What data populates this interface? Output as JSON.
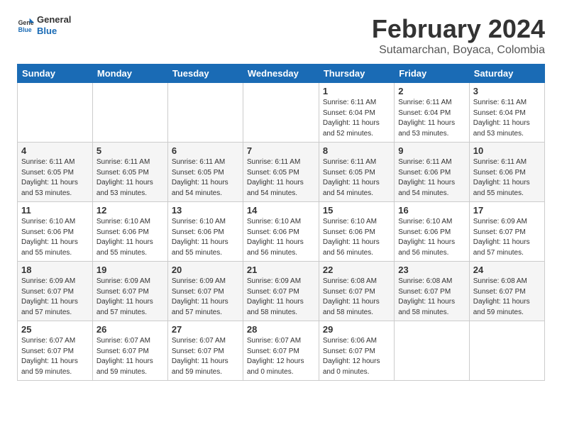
{
  "header": {
    "logo": {
      "general": "General",
      "blue": "Blue"
    },
    "title": "February 2024",
    "subtitle": "Sutamarchan, Boyaca, Colombia"
  },
  "days_of_week": [
    "Sunday",
    "Monday",
    "Tuesday",
    "Wednesday",
    "Thursday",
    "Friday",
    "Saturday"
  ],
  "weeks": [
    [
      {
        "day": "",
        "info": ""
      },
      {
        "day": "",
        "info": ""
      },
      {
        "day": "",
        "info": ""
      },
      {
        "day": "",
        "info": ""
      },
      {
        "day": "1",
        "info": "Sunrise: 6:11 AM\nSunset: 6:04 PM\nDaylight: 11 hours\nand 52 minutes."
      },
      {
        "day": "2",
        "info": "Sunrise: 6:11 AM\nSunset: 6:04 PM\nDaylight: 11 hours\nand 53 minutes."
      },
      {
        "day": "3",
        "info": "Sunrise: 6:11 AM\nSunset: 6:04 PM\nDaylight: 11 hours\nand 53 minutes."
      }
    ],
    [
      {
        "day": "4",
        "info": "Sunrise: 6:11 AM\nSunset: 6:05 PM\nDaylight: 11 hours\nand 53 minutes."
      },
      {
        "day": "5",
        "info": "Sunrise: 6:11 AM\nSunset: 6:05 PM\nDaylight: 11 hours\nand 53 minutes."
      },
      {
        "day": "6",
        "info": "Sunrise: 6:11 AM\nSunset: 6:05 PM\nDaylight: 11 hours\nand 54 minutes."
      },
      {
        "day": "7",
        "info": "Sunrise: 6:11 AM\nSunset: 6:05 PM\nDaylight: 11 hours\nand 54 minutes."
      },
      {
        "day": "8",
        "info": "Sunrise: 6:11 AM\nSunset: 6:05 PM\nDaylight: 11 hours\nand 54 minutes."
      },
      {
        "day": "9",
        "info": "Sunrise: 6:11 AM\nSunset: 6:06 PM\nDaylight: 11 hours\nand 54 minutes."
      },
      {
        "day": "10",
        "info": "Sunrise: 6:11 AM\nSunset: 6:06 PM\nDaylight: 11 hours\nand 55 minutes."
      }
    ],
    [
      {
        "day": "11",
        "info": "Sunrise: 6:10 AM\nSunset: 6:06 PM\nDaylight: 11 hours\nand 55 minutes."
      },
      {
        "day": "12",
        "info": "Sunrise: 6:10 AM\nSunset: 6:06 PM\nDaylight: 11 hours\nand 55 minutes."
      },
      {
        "day": "13",
        "info": "Sunrise: 6:10 AM\nSunset: 6:06 PM\nDaylight: 11 hours\nand 55 minutes."
      },
      {
        "day": "14",
        "info": "Sunrise: 6:10 AM\nSunset: 6:06 PM\nDaylight: 11 hours\nand 56 minutes."
      },
      {
        "day": "15",
        "info": "Sunrise: 6:10 AM\nSunset: 6:06 PM\nDaylight: 11 hours\nand 56 minutes."
      },
      {
        "day": "16",
        "info": "Sunrise: 6:10 AM\nSunset: 6:06 PM\nDaylight: 11 hours\nand 56 minutes."
      },
      {
        "day": "17",
        "info": "Sunrise: 6:09 AM\nSunset: 6:07 PM\nDaylight: 11 hours\nand 57 minutes."
      }
    ],
    [
      {
        "day": "18",
        "info": "Sunrise: 6:09 AM\nSunset: 6:07 PM\nDaylight: 11 hours\nand 57 minutes."
      },
      {
        "day": "19",
        "info": "Sunrise: 6:09 AM\nSunset: 6:07 PM\nDaylight: 11 hours\nand 57 minutes."
      },
      {
        "day": "20",
        "info": "Sunrise: 6:09 AM\nSunset: 6:07 PM\nDaylight: 11 hours\nand 57 minutes."
      },
      {
        "day": "21",
        "info": "Sunrise: 6:09 AM\nSunset: 6:07 PM\nDaylight: 11 hours\nand 58 minutes."
      },
      {
        "day": "22",
        "info": "Sunrise: 6:08 AM\nSunset: 6:07 PM\nDaylight: 11 hours\nand 58 minutes."
      },
      {
        "day": "23",
        "info": "Sunrise: 6:08 AM\nSunset: 6:07 PM\nDaylight: 11 hours\nand 58 minutes."
      },
      {
        "day": "24",
        "info": "Sunrise: 6:08 AM\nSunset: 6:07 PM\nDaylight: 11 hours\nand 59 minutes."
      }
    ],
    [
      {
        "day": "25",
        "info": "Sunrise: 6:07 AM\nSunset: 6:07 PM\nDaylight: 11 hours\nand 59 minutes."
      },
      {
        "day": "26",
        "info": "Sunrise: 6:07 AM\nSunset: 6:07 PM\nDaylight: 11 hours\nand 59 minutes."
      },
      {
        "day": "27",
        "info": "Sunrise: 6:07 AM\nSunset: 6:07 PM\nDaylight: 11 hours\nand 59 minutes."
      },
      {
        "day": "28",
        "info": "Sunrise: 6:07 AM\nSunset: 6:07 PM\nDaylight: 12 hours\nand 0 minutes."
      },
      {
        "day": "29",
        "info": "Sunrise: 6:06 AM\nSunset: 6:07 PM\nDaylight: 12 hours\nand 0 minutes."
      },
      {
        "day": "",
        "info": ""
      },
      {
        "day": "",
        "info": ""
      }
    ]
  ]
}
